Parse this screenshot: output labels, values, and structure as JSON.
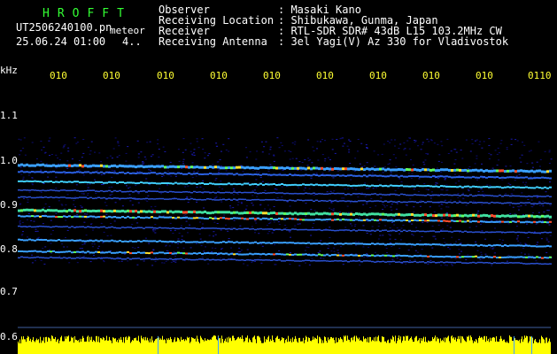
{
  "header": {
    "logo": "HROFFT",
    "filename": "UT2506240100.pn",
    "suffix": "meteor",
    "datetime": "25.06.24 01:00",
    "index": "4..",
    "labels": {
      "observer": "Observer",
      "location": "Receiving Location",
      "receiver": "Receiver",
      "antenna": "Receiving Antenna"
    },
    "values": {
      "observer": ": Masaki Kano",
      "location": ": Shibukawa, Gunma, Japan",
      "receiver": ": RTL-SDR SDR# 43dB L15 103.2MHz CW",
      "antenna": ": 3el Yagi(V) Az 330 for Vladivostok"
    }
  },
  "axis": {
    "y_unit": "kHz",
    "y_ticks": [
      "1.1",
      "1.0",
      "0.9",
      "0.8",
      "0.7",
      "0.6"
    ],
    "x_ticks": [
      "010",
      "010",
      "010",
      "010",
      "010",
      "010",
      "010",
      "010",
      "010",
      "0110"
    ]
  },
  "colors": {
    "background": "#000000",
    "header_green": "#33ff33",
    "tick_yellow": "#ffff33",
    "signal_yellow": "#ffff00",
    "noise_blue": "#1010a0"
  }
}
